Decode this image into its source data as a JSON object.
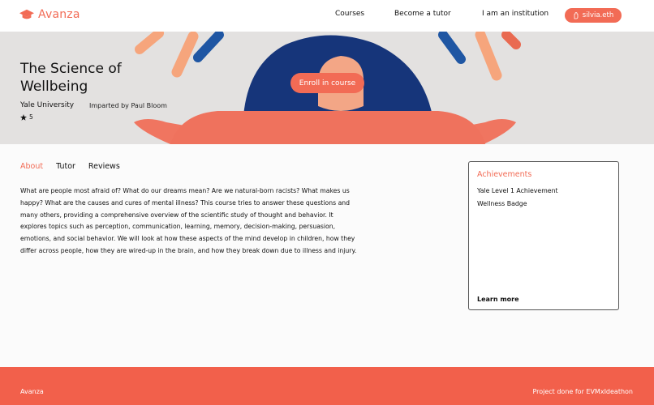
{
  "colors": {
    "accent": "#f26b55",
    "footer": "#f2604b",
    "hero_bg": "#e3e1e0"
  },
  "header": {
    "brand": "Avanza",
    "nav": [
      "Courses",
      "Become a tutor",
      "I am an institution"
    ],
    "wallet": "silvia.eth",
    "icons": {
      "brand": "graduation-cap-icon",
      "wallet": "hand-icon"
    }
  },
  "hero": {
    "title": "The Science of Wellbeing",
    "university": "Yale University",
    "tutor": "Imparted by Paul Bloom",
    "rating": "5",
    "enroll_label": "Enroll in course"
  },
  "tabs": {
    "items": [
      "About",
      "Tutor",
      "Reviews"
    ],
    "active": "About"
  },
  "about_text": "What are people most afraid of? What do our dreams mean? Are we natural-born racists? What makes us happy? What are the causes and cures of mental illness? This course tries to answer these questions and many others, providing a comprehensive overview of the scientific study of thought and behavior. It explores topics such as perception, communication, learning, memory, decision-making, persuasion, emotions, and social behavior.  We will look at how these aspects of the mind develop in children, how they differ across people, how they are wired-up in the brain, and how they break down due to illness and injury.",
  "achievements": {
    "title": "Achievements",
    "items": [
      "Yale Level 1 Achievement",
      "Wellness Badge"
    ],
    "learn_more": "Learn more"
  },
  "footer": {
    "left": "Avanza",
    "right": "Project done for EVMxIdeathon"
  }
}
